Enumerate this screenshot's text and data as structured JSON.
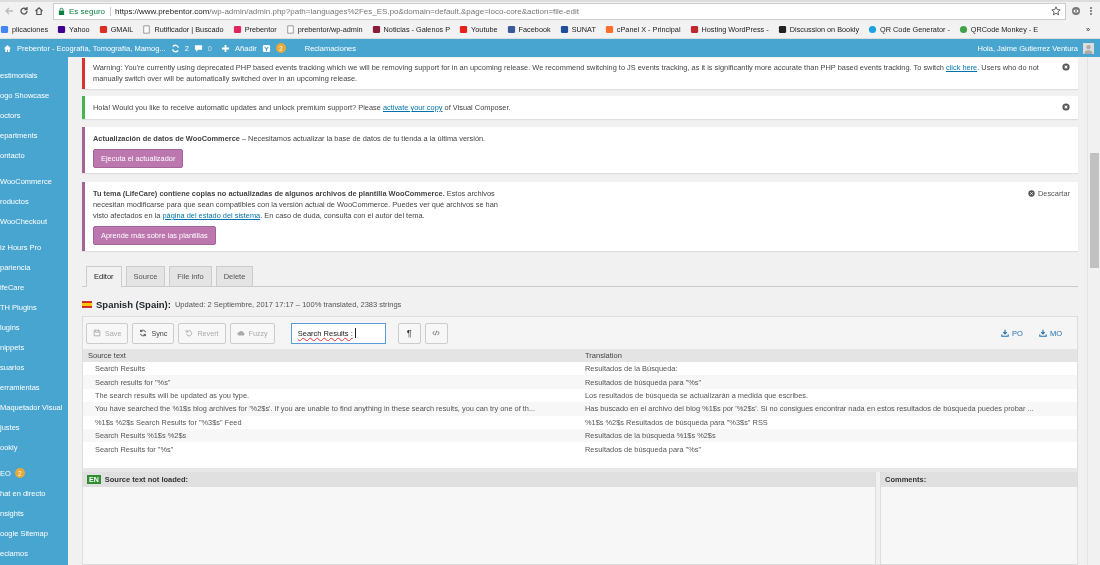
{
  "browser": {
    "secure_label": "Es seguro",
    "url_host": "https://www.prebentor.com",
    "url_path": "/wp-admin/admin.php?path=languages%2Fes_ES.po&domain=default.&page=loco-core&action=file-edit",
    "bookmarks": [
      {
        "label": "plicaciones",
        "kind": "apps"
      },
      {
        "label": "Yahoo",
        "kind": "yahoo"
      },
      {
        "label": "GMAIL",
        "kind": "gmail"
      },
      {
        "label": "Rutificador | Buscado",
        "kind": "page"
      },
      {
        "label": "Prebentor",
        "kind": "brand"
      },
      {
        "label": "prebentor/wp-admin",
        "kind": "page"
      },
      {
        "label": "Noticias - Galenos P",
        "kind": "news"
      },
      {
        "label": "Youtube",
        "kind": "video"
      },
      {
        "label": "Facebook",
        "kind": "facebook"
      },
      {
        "label": "SUNAT",
        "kind": "sunat"
      },
      {
        "label": "cPanel X - Principal",
        "kind": "cpanel"
      },
      {
        "label": "Hosting WordPress -",
        "kind": "hosting"
      },
      {
        "label": "Discussion on Bookly",
        "kind": "bird"
      },
      {
        "label": "QR Code Generator -",
        "kind": "qr"
      },
      {
        "label": "QRCode Monkey - E",
        "kind": "globe"
      }
    ],
    "more": "»"
  },
  "admin_bar": {
    "site_title": "Prebentor - Ecografía, Tomografía, Mamog...",
    "updates": "2",
    "comments": "0",
    "add_label": "Añadir",
    "seo_badge": "2",
    "link": "Reclamaciones",
    "greeting": "Hola, Jaime Gutierrez Ventura"
  },
  "sidebar": {
    "groups": [
      [
        {
          "label": "estimonials"
        },
        {
          "label": "ogo Showcase"
        },
        {
          "label": "octors"
        },
        {
          "label": "epartments"
        },
        {
          "label": "ontacto"
        }
      ],
      [
        {
          "label": "WooCommerce"
        },
        {
          "label": "roductos"
        },
        {
          "label": "WooCheckout"
        }
      ],
      [
        {
          "label": "iz Hours Pro"
        },
        {
          "label": "pariencia"
        },
        {
          "label": "ifeCare"
        },
        {
          "label": "TH Plugins"
        },
        {
          "label": "lugins"
        },
        {
          "label": "nippets"
        },
        {
          "label": "suarios"
        },
        {
          "label": "erramientas"
        },
        {
          "label": "Maquetador Visual"
        },
        {
          "label": "justes"
        },
        {
          "label": "ookly"
        }
      ],
      [
        {
          "label": "EO",
          "badge": "2"
        },
        {
          "label": "hat en directo"
        },
        {
          "label": "nsights"
        },
        {
          "label": "oogle Sitemap"
        },
        {
          "label": "eclamos"
        }
      ]
    ]
  },
  "notices": [
    {
      "color": "#dc3232",
      "dismissible": true,
      "segments": [
        {
          "kind": "plain",
          "text": "Warning: You're currently using deprecated PHP based events tracking which we will be removing support for in an upcoming release. We recommend switching to JS events tracking, as it is significantly more accurate than PHP based events tracking. To switch "
        },
        {
          "kind": "link",
          "text": "click here"
        },
        {
          "kind": "plain",
          "text": ". Users who do not manually switch over will be automatically switched over in an upcoming release."
        }
      ]
    },
    {
      "color": "#46b450",
      "dismissible": true,
      "segments": [
        {
          "kind": "plain",
          "text": "Hola! Would you like to receive automatic updates and unlock premium support? Please "
        },
        {
          "kind": "link",
          "text": "activate your copy"
        },
        {
          "kind": "plain",
          "text": " of Visual Composer."
        }
      ]
    },
    {
      "color": "#a46497",
      "dismissible": false,
      "segments": [
        {
          "kind": "bold",
          "text": "Actualización de datos de WooCommerce"
        },
        {
          "kind": "plain",
          "text": " – Necesitamos actualizar la base de datos de tu tienda a la última versión."
        }
      ],
      "button": "Ejecuta el actualizador"
    },
    {
      "color": "#a46497",
      "dismissible": false,
      "dismiss_label": "Descartar",
      "segments": [
        {
          "kind": "bold",
          "text": "Tu tema (LifeCare) contiene copias no actualizadas de algunos archivos de plantilla WooCommerce."
        },
        {
          "kind": "plain",
          "text": " Estos archivos necesitan modificarse para que sean compatibles con la versión actual de WooCommerce. Puedes ver qué archivos se han visto afectados en la "
        },
        {
          "kind": "link",
          "text": "página del estado del sistema"
        },
        {
          "kind": "plain",
          "text": ". En caso de duda, consulta con el autor del tema."
        }
      ],
      "button": "Aprende más sobre las plantillas"
    }
  ],
  "tabs": [
    {
      "label": "Editor",
      "selected": true
    },
    {
      "label": "Source",
      "selected": false
    },
    {
      "label": "File info",
      "selected": false
    },
    {
      "label": "Delete",
      "selected": false
    }
  ],
  "file_header": {
    "language": "Spanish (Spain):",
    "meta": "Updated: 2 Septiembre, 2017 17:17 – 100% translated, 2383 strings"
  },
  "toolbar": {
    "buttons": [
      {
        "label": "Save",
        "disabled": true
      },
      {
        "label": "Sync",
        "disabled": false
      },
      {
        "label": "Revert",
        "disabled": true
      },
      {
        "label": "Fuzzy",
        "disabled": true
      }
    ],
    "search_value": "Search Results :",
    "pilcrow": "¶",
    "downloads": [
      "PO",
      "MO"
    ]
  },
  "table": {
    "columns": [
      "Source text",
      "Translation"
    ],
    "rows": [
      {
        "source": "Search Results",
        "translation": "Resultados de la Búsqueda:"
      },
      {
        "source": "Search results for \"%s\"",
        "translation": "Resultados de búsqueda para \"%s\""
      },
      {
        "source": "The search results will be updated as you type.",
        "translation": "Los resultados de búsqueda se actualizarán a medida que escribes."
      },
      {
        "source": "You have searched the %1$s blog archives for '%2$s'. If you are unable to find anything in these search results, you can try one of th...",
        "translation": "Has buscado en el archivo del blog %1$s por '%2$s'. Si no consigues encontrar nada en estos resultados de búsqueda puedes probar ..."
      },
      {
        "source": "%1$s %2$s Search Results for \"%3$s\" Feed",
        "translation": "%1$s %2$s Resultados de búsqueda para \"%3$s\" RSS"
      },
      {
        "source": "Search Results %1$s %2$s",
        "translation": "Resultados de la búsqueda %1$s %2$s"
      },
      {
        "source": "Search Results for \"%s\"",
        "translation": "Resultados de búsqueda para \"%s\""
      }
    ]
  },
  "source_panel": {
    "badge": "EN",
    "title": "Source text not loaded:"
  },
  "comments_panel": {
    "title": "Comments:"
  }
}
